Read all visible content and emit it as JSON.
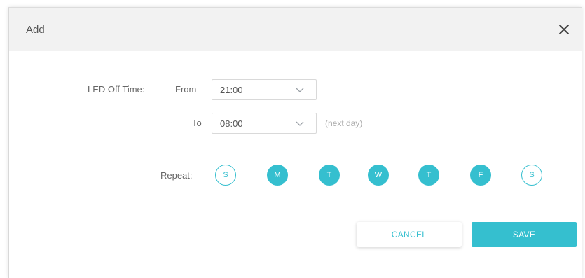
{
  "dialog": {
    "title": "Add",
    "close_icon": "close-icon"
  },
  "form": {
    "led_off_label": "LED Off Time:",
    "from_label": "From",
    "from_value": "21:00",
    "to_label": "To",
    "to_value": "08:00",
    "next_day_note": "(next day)",
    "repeat_label": "Repeat:",
    "days": [
      {
        "letter": "S",
        "selected": false
      },
      {
        "letter": "M",
        "selected": true
      },
      {
        "letter": "T",
        "selected": true
      },
      {
        "letter": "W",
        "selected": true
      },
      {
        "letter": "T",
        "selected": true
      },
      {
        "letter": "F",
        "selected": true
      },
      {
        "letter": "S",
        "selected": false
      }
    ]
  },
  "buttons": {
    "cancel": "CANCEL",
    "save": "SAVE"
  },
  "colors": {
    "accent": "#35bfcf",
    "header_bg": "#f2f2f2"
  }
}
